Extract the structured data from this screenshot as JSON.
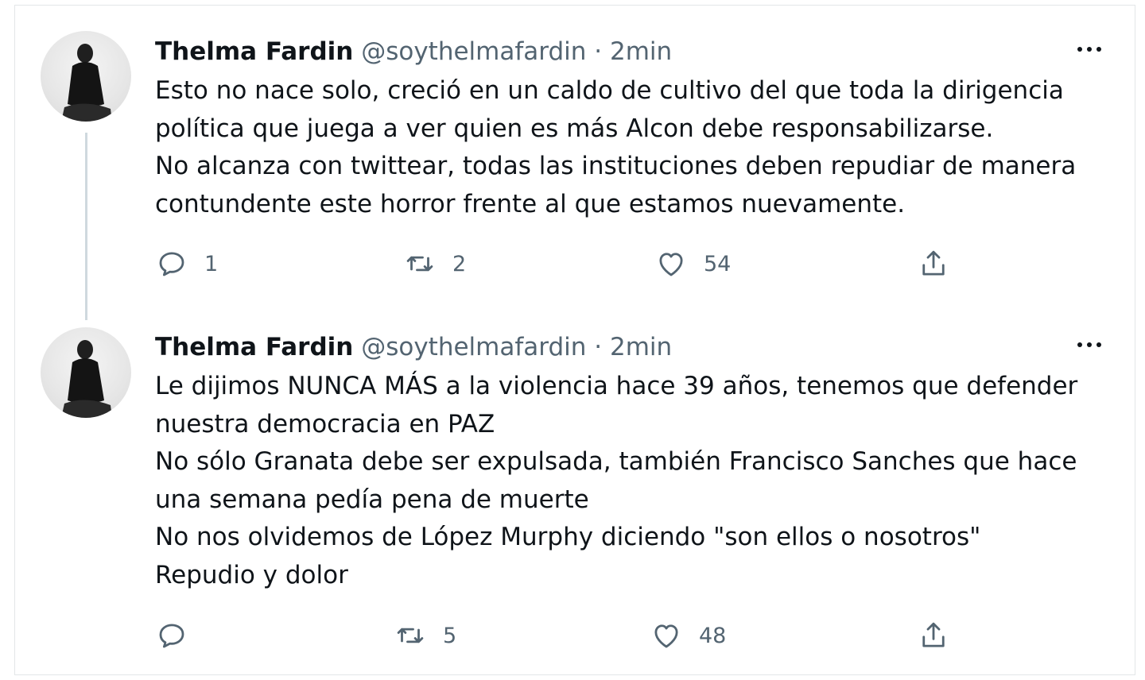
{
  "tweets": [
    {
      "author_name": "Thelma Fardin",
      "handle": "@soythelmafardin",
      "separator": "·",
      "time": "2min",
      "lines": [
        "Esto no nace solo, creció en un caldo de cultivo del que toda la dirigencia",
        "política que juega a ver quien es más Alcon debe responsabilizarse.",
        "No alcanza con twittear, todas las instituciones deben repudiar de manera",
        "contundente este horror frente al que estamos nuevamente."
      ],
      "replies": "1",
      "retweets": "2",
      "likes": "54"
    },
    {
      "author_name": "Thelma Fardin",
      "handle": "@soythelmafardin",
      "separator": "·",
      "time": "2min",
      "lines": [
        "Le dijimos NUNCA MÁS a la violencia hace 39 años, tenemos que defender",
        "nuestra democracia en PAZ",
        "No sólo Granata debe ser expulsada, también Francisco Sanches que hace",
        "una semana pedía pena de muerte",
        "No nos olvidemos de López Murphy diciendo \"son ellos o nosotros\"",
        "Repudio y dolor"
      ],
      "replies": "",
      "retweets": "5",
      "likes": "48"
    }
  ],
  "icons": {
    "reply": "reply-icon",
    "retweet": "retweet-icon",
    "like": "heart-icon",
    "share": "share-icon",
    "more": "more-icon"
  },
  "colors": {
    "text_primary": "#0f1419",
    "text_secondary": "#536471",
    "thread_line": "#cfd9de",
    "border": "#e3e6e8"
  }
}
